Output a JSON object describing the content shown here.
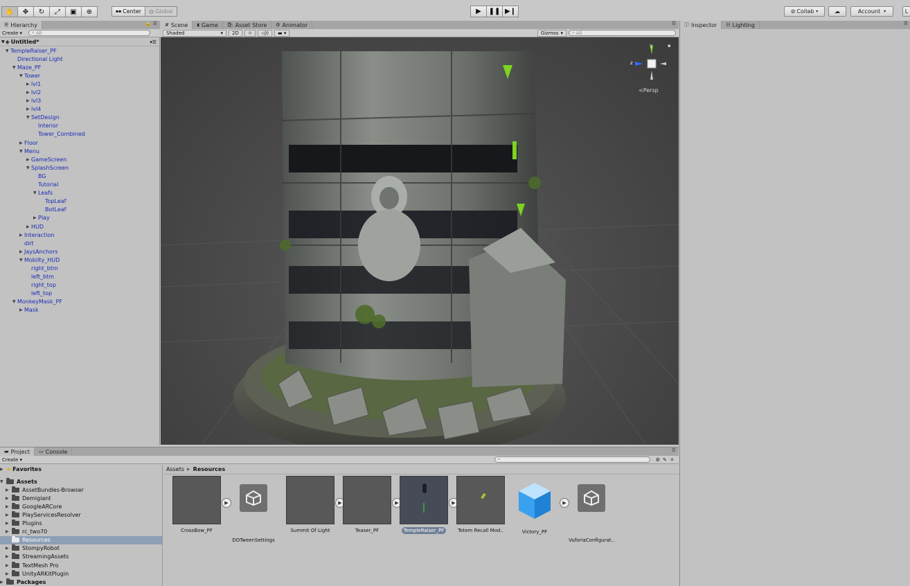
{
  "toolbar": {
    "tools": [
      "hand-icon",
      "move-icon",
      "rotate-icon",
      "scale-icon",
      "rect-icon",
      "transform-icon"
    ],
    "pivot_label": "Center",
    "space_label": "Global",
    "play": [
      "play-icon",
      "pause-icon",
      "step-icon"
    ],
    "collab_label": "Collab",
    "account_label": "Account",
    "layers_label": "L"
  },
  "hierarchy": {
    "tab_label": "Hierarchy",
    "create_label": "Create",
    "search_placeholder": "All",
    "scene_name": "Untitled*",
    "items": [
      {
        "label": "TempleRaiser_PF",
        "depth": 0,
        "fold": "open"
      },
      {
        "label": "Directional Light",
        "depth": 1,
        "fold": "none"
      },
      {
        "label": "Maze_PF",
        "depth": 1,
        "fold": "open"
      },
      {
        "label": "Tower",
        "depth": 2,
        "fold": "open"
      },
      {
        "label": "lvl1",
        "depth": 3,
        "fold": "closed"
      },
      {
        "label": "lvl2",
        "depth": 3,
        "fold": "closed"
      },
      {
        "label": "lvl3",
        "depth": 3,
        "fold": "closed"
      },
      {
        "label": "lvl4",
        "depth": 3,
        "fold": "closed"
      },
      {
        "label": "SetDesign",
        "depth": 3,
        "fold": "open"
      },
      {
        "label": "Interior",
        "depth": 4,
        "fold": "none"
      },
      {
        "label": "Tower_Combined",
        "depth": 4,
        "fold": "none"
      },
      {
        "label": "Floor",
        "depth": 2,
        "fold": "closed"
      },
      {
        "label": "Menu",
        "depth": 2,
        "fold": "open"
      },
      {
        "label": "GameScreen",
        "depth": 3,
        "fold": "closed"
      },
      {
        "label": "SplashScreen",
        "depth": 3,
        "fold": "open"
      },
      {
        "label": "BG",
        "depth": 4,
        "fold": "none"
      },
      {
        "label": "Tutorial",
        "depth": 4,
        "fold": "none"
      },
      {
        "label": "Leafs",
        "depth": 4,
        "fold": "open"
      },
      {
        "label": "TopLeaf",
        "depth": 5,
        "fold": "none"
      },
      {
        "label": "BotLeaf",
        "depth": 5,
        "fold": "none"
      },
      {
        "label": "Play",
        "depth": 4,
        "fold": "closed"
      },
      {
        "label": "HUD",
        "depth": 3,
        "fold": "closed"
      },
      {
        "label": "Interaction",
        "depth": 2,
        "fold": "closed"
      },
      {
        "label": "dirt",
        "depth": 2,
        "fold": "none"
      },
      {
        "label": "JaysAnchors",
        "depth": 2,
        "fold": "closed"
      },
      {
        "label": "Mobilty_HUD",
        "depth": 2,
        "fold": "open"
      },
      {
        "label": "right_btm",
        "depth": 3,
        "fold": "none"
      },
      {
        "label": "left_btm",
        "depth": 3,
        "fold": "none"
      },
      {
        "label": "right_top",
        "depth": 3,
        "fold": "none"
      },
      {
        "label": "left_top",
        "depth": 3,
        "fold": "none"
      },
      {
        "label": "MonkeyMask_PF",
        "depth": 1,
        "fold": "open"
      },
      {
        "label": "Mask",
        "depth": 2,
        "fold": "closed"
      }
    ]
  },
  "scene": {
    "tabs": [
      {
        "label": "Scene",
        "icon": "grid-icon"
      },
      {
        "label": "Game",
        "icon": "pacman-icon"
      },
      {
        "label": "Asset Store",
        "icon": "store-icon"
      },
      {
        "label": "Animator",
        "icon": "animator-icon"
      }
    ],
    "shading_label": "Shaded",
    "mode_2d_label": "2D",
    "gizmos_label": "Gizmos",
    "search_placeholder": "All",
    "persp_label": "Persp",
    "axis_labels": {
      "y": "y",
      "z": "z"
    }
  },
  "inspector": {
    "tabs": [
      {
        "label": "Inspector",
        "icon": "info-icon"
      },
      {
        "label": "Lighting",
        "icon": "lighting-icon"
      }
    ]
  },
  "project": {
    "tabs": [
      {
        "label": "Project",
        "icon": "folder-icon"
      },
      {
        "label": "Console",
        "icon": "console-icon"
      }
    ],
    "create_label": "Create",
    "favorites_label": "Favorites",
    "assets_label": "Assets",
    "folders": [
      {
        "label": "AssetBundles-Browser",
        "selected": false
      },
      {
        "label": "Demigiant",
        "selected": false
      },
      {
        "label": "GoogleARCore",
        "selected": false
      },
      {
        "label": "PlayServicesResolver",
        "selected": false
      },
      {
        "label": "Plugins",
        "selected": false
      },
      {
        "label": "rc_two70",
        "selected": false
      },
      {
        "label": "Resources",
        "selected": true
      },
      {
        "label": "StompyRobot",
        "selected": false
      },
      {
        "label": "StreamingAssets",
        "selected": false
      },
      {
        "label": "TextMesh Pro",
        "selected": false
      },
      {
        "label": "UnityARKitPlugin",
        "selected": false
      }
    ],
    "packages_label": "Packages",
    "breadcrumb": [
      "Assets",
      "Resources"
    ],
    "assets": [
      {
        "label": "CrossBow_PF",
        "kind": "prefab",
        "selected": false,
        "expander": true
      },
      {
        "label": "DOTweenSettings",
        "kind": "unity",
        "selected": false,
        "expander": false
      },
      {
        "label": "Summit Of Light",
        "kind": "prefab",
        "selected": false,
        "expander": true
      },
      {
        "label": "Teaser_PF",
        "kind": "prefab",
        "selected": false,
        "expander": true
      },
      {
        "label": "TempleRaiser_PF",
        "kind": "prefab-dark",
        "selected": true,
        "expander": true
      },
      {
        "label": "Totem Recall Mod..",
        "kind": "prefab-leaf",
        "selected": false,
        "expander": false
      },
      {
        "label": "Victory_PF",
        "kind": "cube",
        "selected": false,
        "expander": true
      },
      {
        "label": "VuforiaConfigurat..",
        "kind": "unity",
        "selected": false,
        "expander": false
      }
    ]
  },
  "colors": {
    "selection": "#8d9fb5",
    "tree_text_blue": "#1a2bb5",
    "viewport_bg": "#474747",
    "gizmo_green": "#7ed321",
    "gizmo_blue": "#2e6bff"
  }
}
